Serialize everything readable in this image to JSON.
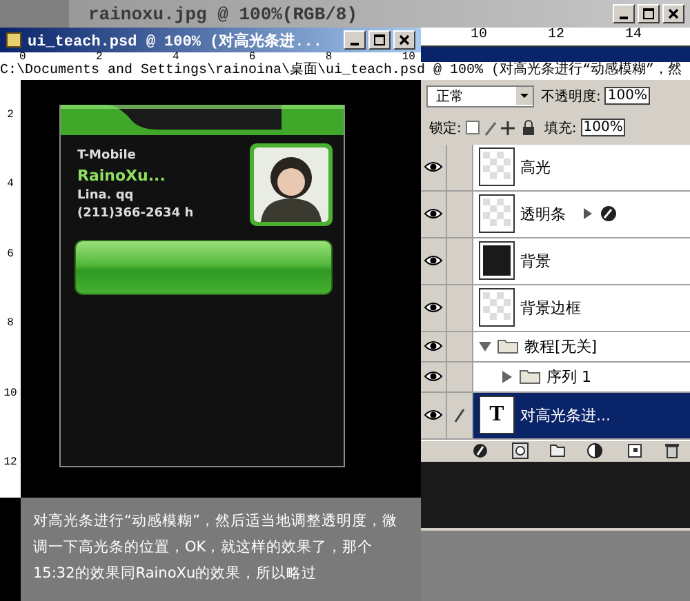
{
  "back_window": {
    "title": "rainoxu.jpg @ 100%(RGB/8)",
    "ruler_marks": [
      "10",
      "12",
      "14"
    ]
  },
  "document_window": {
    "title": "ui_teach.psd @ 100% (对高光条进...",
    "ruler_marks": [
      "0",
      "2",
      "4",
      "6",
      "8",
      "10"
    ],
    "vertical_ruler_marks": [
      "2",
      "4",
      "6",
      "8",
      "10",
      "12"
    ]
  },
  "path_tooltip": "C:\\Documents and Settings\\rainoina\\桌面\\ui_teach.psd @ 100% (对高光条进行“动感模糊”，然",
  "phone_card": {
    "carrier": "T-Mobile",
    "name": "RainoXu...",
    "note": "Lina. qq",
    "phone": "(211)366-2634 h"
  },
  "caption": "对高光条进行“动感模糊”，然后适当地调整透明度，微调一下高光条的位置，OK，就这样的效果了，那个15:32的效果同RainoXu的效果，所以略过",
  "layers_panel": {
    "blend_mode": "正常",
    "opacity_label": "不透明度:",
    "opacity": "100%",
    "lock_label": "锁定:",
    "fill_label": "填充:",
    "fill": "100%",
    "layers": [
      {
        "name": "高光",
        "kind": "layer",
        "visible": true,
        "has_effects": false,
        "selected": false
      },
      {
        "name": "透明条",
        "kind": "layer",
        "visible": true,
        "has_effects": true,
        "selected": false
      },
      {
        "name": "背景",
        "kind": "solid_layer",
        "visible": true,
        "has_effects": false,
        "selected": false
      },
      {
        "name": "背景边框",
        "kind": "layer",
        "visible": true,
        "has_effects": false,
        "selected": false
      },
      {
        "name": "教程[无关]",
        "kind": "group",
        "visible": true,
        "expanded": true,
        "selected": false,
        "children": [
          {
            "name": "序列 1",
            "kind": "group",
            "visible": true,
            "expanded": false,
            "selected": false
          }
        ]
      },
      {
        "name": "对高光条进...",
        "kind": "text",
        "thumb_glyph": "T",
        "visible": true,
        "selected": true
      }
    ]
  }
}
